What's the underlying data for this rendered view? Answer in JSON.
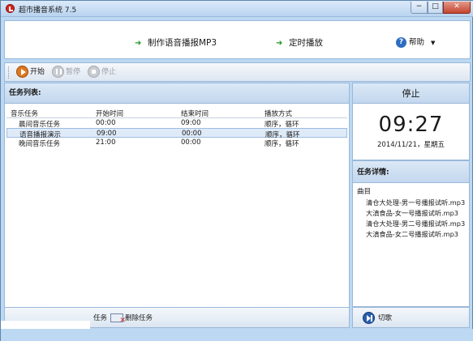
{
  "window": {
    "title": "超市播音系统 7.5"
  },
  "header": {
    "make_mp3_label": "制作语音播报MP3",
    "timer_label": "定时播放",
    "help_label": "帮助"
  },
  "toolbar": {
    "start_label": "开始",
    "pause_label": "暂停",
    "stop_label": "停止"
  },
  "task_list": {
    "title": "任务列表:",
    "columns": [
      "音乐任务",
      "开始时间",
      "结束时间",
      "播放方式"
    ],
    "rows": [
      {
        "name": "晨间音乐任务",
        "start": "00:00",
        "end": "09:00",
        "mode": "顺序，循环"
      },
      {
        "name": "语音播报演示",
        "start": "09:00",
        "end": "00:00",
        "mode": "顺序，循环"
      },
      {
        "name": "晚间音乐任务",
        "start": "21:00",
        "end": "00:00",
        "mode": "顺序，循环"
      }
    ],
    "selected_row": 1,
    "add_task_label": "任务",
    "delete_task_label": "删除任务"
  },
  "status": {
    "state_label": "停止",
    "clock_time": "09:27",
    "clock_date": "2014/11/21，星期五"
  },
  "details": {
    "title": "任务详情:",
    "column_header": "曲目",
    "tracks": [
      "清仓大处理-男一号播报试听.mp3",
      "大滇食品-女一号播报试听.mp3",
      "清仓大处理-男二号播报试听.mp3",
      "大滇食品-女二号播报试听.mp3"
    ],
    "next_label": "切歌"
  },
  "colors": {
    "frame_blue": "#bcd8f2",
    "header_gradient_top": "#dbe8f6",
    "arrow_green": "#1e9a2a",
    "play_orange": "#e0771d",
    "close_red": "#c4452f"
  },
  "icons": [
    "app-icon",
    "arrow-right-icon",
    "help-icon",
    "play-icon",
    "pause-icon",
    "stop-icon",
    "delete-task-icon",
    "next-track-icon"
  ]
}
